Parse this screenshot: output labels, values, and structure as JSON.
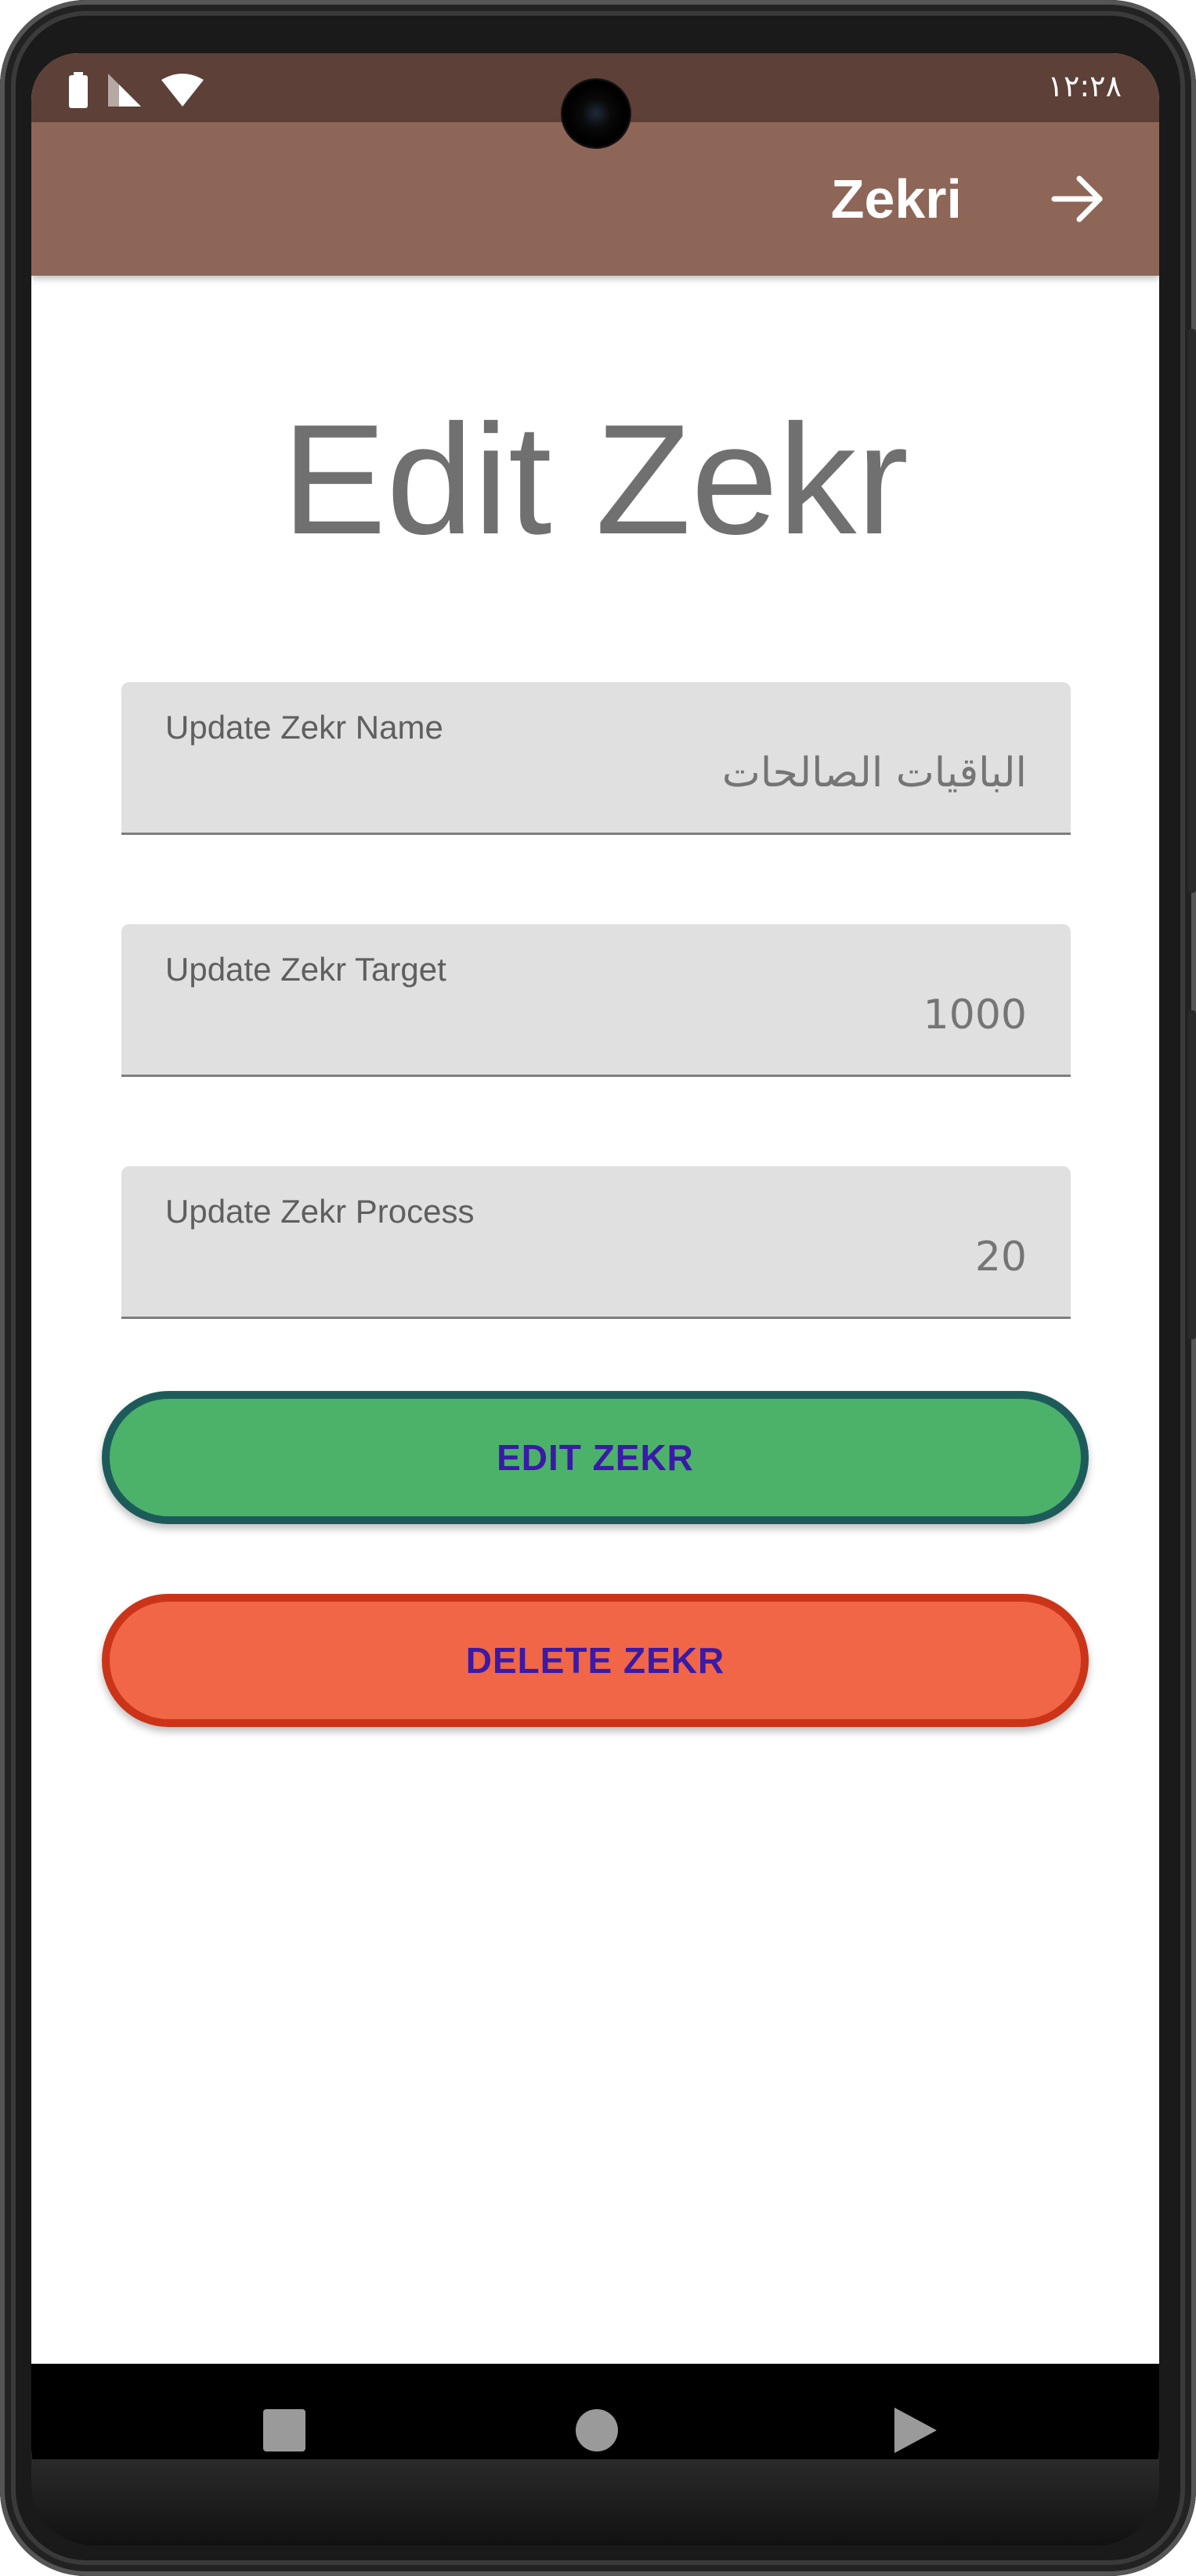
{
  "status_bar": {
    "time": "١٢:٢٨",
    "icons": [
      "battery-icon",
      "signal-icon",
      "wifi-icon"
    ]
  },
  "app_bar": {
    "title": "Zekri",
    "action_icon": "arrow-forward-icon"
  },
  "page": {
    "title": "Edit Zekr"
  },
  "form": {
    "name_field": {
      "label": "Update Zekr Name",
      "placeholder": "الباقيات الصالحات"
    },
    "target_field": {
      "label": "Update Zekr Target",
      "placeholder": "1000"
    },
    "process_field": {
      "label": "Update Zekr Process",
      "placeholder": "20"
    }
  },
  "buttons": {
    "edit_label": "EDIT ZEKR",
    "delete_label": "DELETE ZEKR"
  },
  "nav_bar": {
    "icons": [
      "recents-square-icon",
      "home-circle-icon",
      "back-triangle-icon"
    ]
  },
  "colors": {
    "status_bar": "#5d4037",
    "app_bar": "#8d6658",
    "edit_button": "#4cb26a",
    "edit_border": "#1d5b5a",
    "delete_button": "#f06647",
    "delete_border": "#cb3418",
    "button_text": "#3a1aa6"
  }
}
